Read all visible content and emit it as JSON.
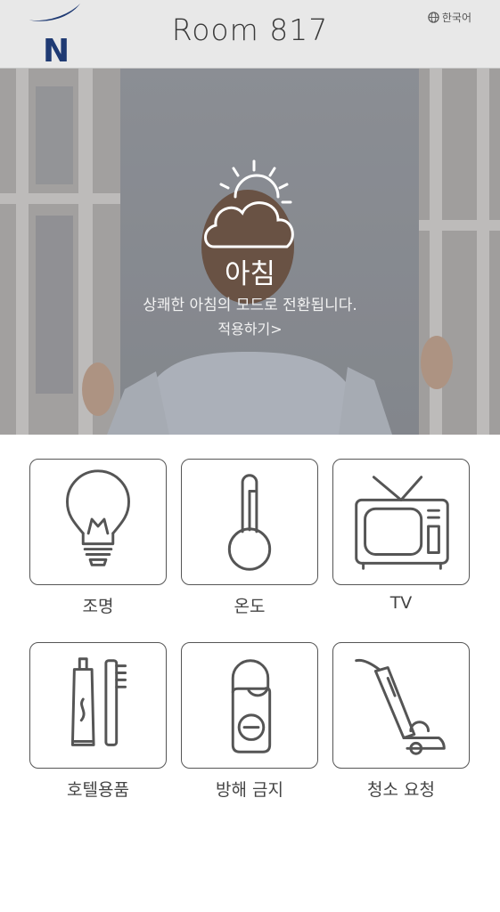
{
  "header": {
    "room_title": "Room 817",
    "language_label": "한국어",
    "logo_letter": "N",
    "brand_color": "#1f3a73"
  },
  "hero": {
    "mode_title": "아침",
    "mode_description": "상쾌한 아침의 모드로 전환됩니다.",
    "apply_link": "적용하기>",
    "icon": "sun-cloud-icon"
  },
  "services": [
    {
      "label": "조명",
      "icon": "light-bulb-icon"
    },
    {
      "label": "온도",
      "icon": "thermometer-icon"
    },
    {
      "label": "TV",
      "icon": "tv-icon"
    },
    {
      "label": "호텔용품",
      "icon": "toothbrush-toothpaste-icon"
    },
    {
      "label": "방해 금지",
      "icon": "do-not-disturb-hanger-icon"
    },
    {
      "label": "청소 요청",
      "icon": "vacuum-cleaner-icon"
    }
  ]
}
